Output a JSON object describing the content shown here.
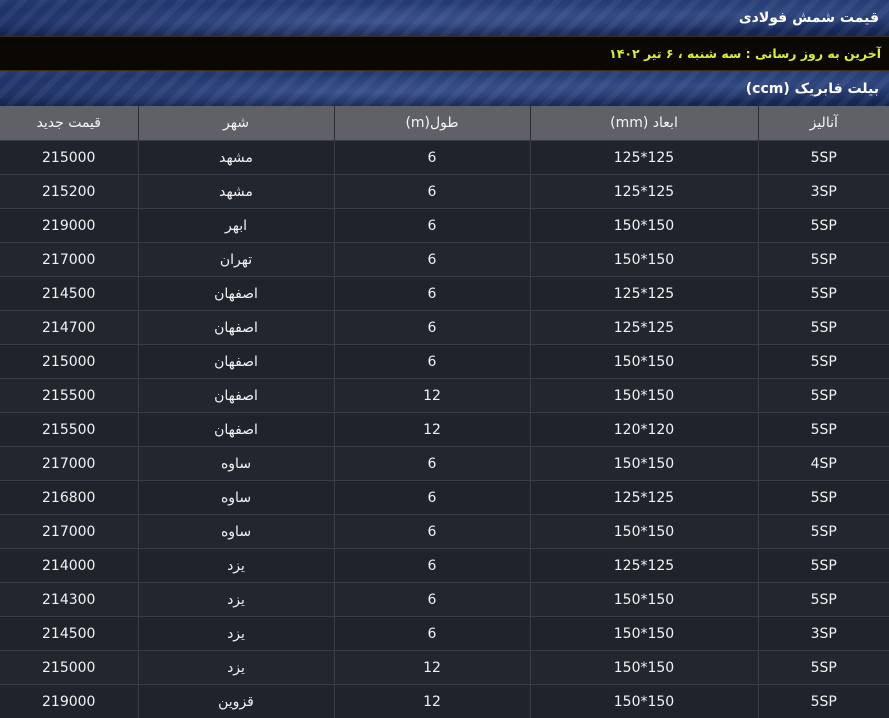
{
  "header": {
    "title": "قیمت شمش فولادی"
  },
  "update": {
    "text": "آخرین به روز رسانی : سه شنبه ، ۶ تیر ۱۴۰۲"
  },
  "section": {
    "title": "بیلت فابریک (ccm)"
  },
  "table": {
    "columns": [
      "آنالیز",
      "ابعاد (mm)",
      "طول(m)",
      "شهر",
      "قیمت جدید"
    ],
    "rows": [
      [
        "5SP",
        "125*125",
        "6",
        "مشهد",
        "215000"
      ],
      [
        "3SP",
        "125*125",
        "6",
        "مشهد",
        "215200"
      ],
      [
        "5SP",
        "150*150",
        "6",
        "ابهر",
        "219000"
      ],
      [
        "5SP",
        "150*150",
        "6",
        "تهران",
        "217000"
      ],
      [
        "5SP",
        "125*125",
        "6",
        "اصفهان",
        "214500"
      ],
      [
        "5SP",
        "125*125",
        "6",
        "اصفهان",
        "214700"
      ],
      [
        "5SP",
        "150*150",
        "6",
        "اصفهان",
        "215000"
      ],
      [
        "5SP",
        "150*150",
        "12",
        "اصفهان",
        "215500"
      ],
      [
        "5SP",
        "120*120",
        "12",
        "اصفهان",
        "215500"
      ],
      [
        "4SP",
        "150*150",
        "6",
        "ساوه",
        "217000"
      ],
      [
        "5SP",
        "125*125",
        "6",
        "ساوه",
        "216800"
      ],
      [
        "5SP",
        "150*150",
        "6",
        "ساوه",
        "217000"
      ],
      [
        "5SP",
        "125*125",
        "6",
        "یزد",
        "214000"
      ],
      [
        "5SP",
        "150*150",
        "6",
        "یزد",
        "214300"
      ],
      [
        "3SP",
        "150*150",
        "6",
        "یزد",
        "214500"
      ],
      [
        "5SP",
        "150*150",
        "12",
        "یزد",
        "215000"
      ],
      [
        "5SP",
        "150*150",
        "12",
        "قزوین",
        "219000"
      ]
    ]
  }
}
